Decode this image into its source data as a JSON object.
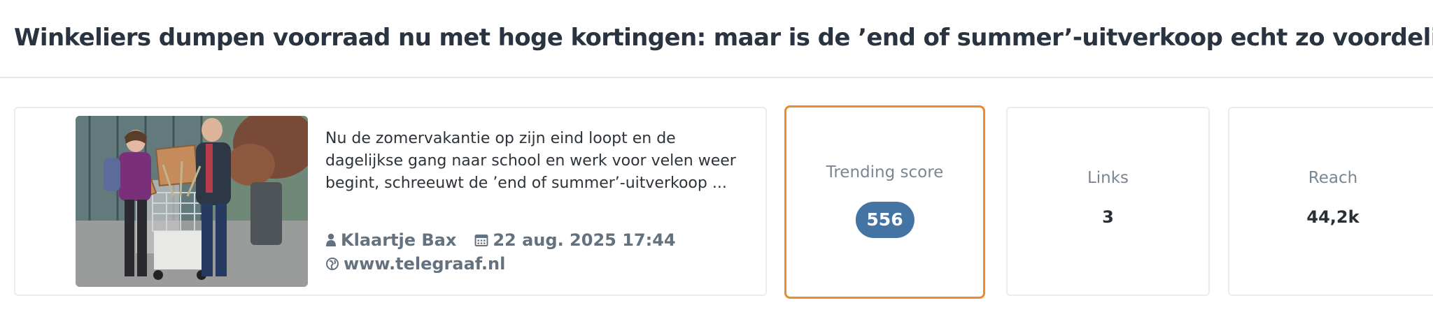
{
  "article": {
    "headline": "Winkeliers dumpen voorraad nu met hoge kortingen: maar is de ’end of summer’-uitverkoop echt zo voordelig?",
    "excerpt": "Nu de zomervakantie op zijn eind loopt en de dagelijkse gang naar school en werk voor velen weer begint, schreeuwt de ’end of summer’-uitverkoop ...",
    "author": "Klaartje Bax",
    "date": "22 aug. 2025 17:44",
    "source": "www.telegraaf.nl",
    "icons": {
      "author": "person-icon",
      "date": "calendar-icon",
      "source": "globe-icon"
    }
  },
  "stats": {
    "trending": {
      "label": "Trending score",
      "value": "556"
    },
    "links": {
      "label": "Links",
      "value": "3"
    },
    "reach": {
      "label": "Reach",
      "value": "44,2k"
    }
  },
  "colors": {
    "accent_border": "#ee8a2e",
    "score_pill": "#4474a4",
    "meta_text": "#647280",
    "headline_text": "#2a3440"
  }
}
